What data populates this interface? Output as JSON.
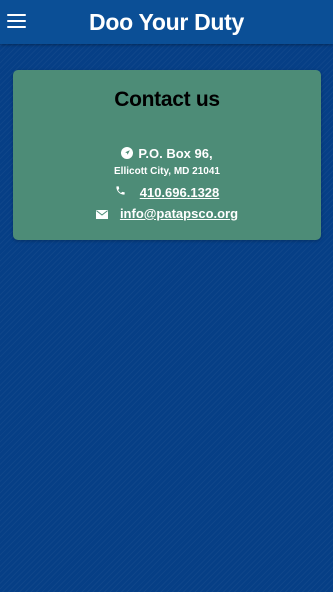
{
  "app_bar": {
    "title": "Doo Your Duty",
    "menu_icon": "hamburger-menu-icon"
  },
  "contact": {
    "title": "Contact us",
    "address_line1": "P.O. Box 96,",
    "address_line2": "Ellicott City, MD 21041",
    "phone": "410.696.1328",
    "email": "info@patapsco.org",
    "icons": {
      "address": "navigation-arrow-icon",
      "phone": "phone-icon",
      "email": "envelope-icon"
    }
  },
  "colors": {
    "app_bar": "#0b4f96",
    "background": "#063f86",
    "card": "#4d8c77",
    "title_text": "#000000",
    "body_text": "#ffffff"
  }
}
